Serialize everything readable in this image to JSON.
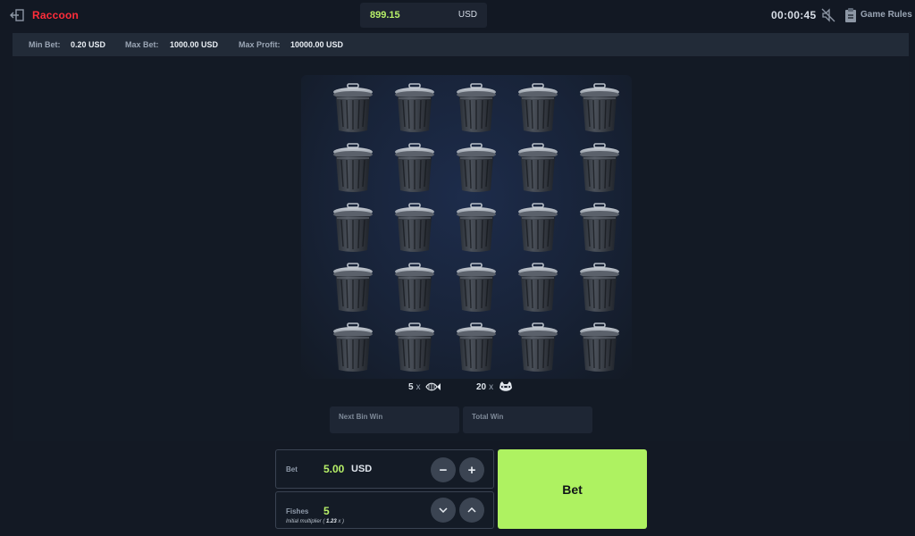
{
  "header": {
    "brand": "Raccoon",
    "balance_amount": "899.15",
    "balance_currency": "USD",
    "timer": "00:00:45",
    "rules_label": "Game Rules",
    "icons": [
      "back-icon",
      "sound-off-icon",
      "clipboard-icon"
    ]
  },
  "limits": {
    "min_bet_label": "Min Bet:",
    "min_bet_value": "0.20 USD",
    "max_bet_label": "Max Bet:",
    "max_bet_value": "1000.00 USD",
    "max_profit_label": "Max Profit:",
    "max_profit_value": "10000.00 USD"
  },
  "board": {
    "rows": 5,
    "cols": 5,
    "bin_icon": "trash-bin-icon"
  },
  "counters": {
    "fish_count": "5",
    "fish_suffix": "x",
    "fish_icon": "fish-icon",
    "raccoon_count": "20",
    "raccoon_suffix": "x",
    "raccoon_icon": "raccoon-icon"
  },
  "wins": {
    "next_bin_label": "Next Bin Win",
    "total_label": "Total Win"
  },
  "controls": {
    "bet_label": "Bet",
    "bet_value": "5.00",
    "bet_currency": "USD",
    "minus": "−",
    "plus": "+",
    "fishes_label": "Fishes",
    "fishes_value": "5",
    "initial_multiplier_label": "Initial multiplier (",
    "initial_multiplier_value": "1.23",
    "initial_multiplier_suffix": "x )",
    "bet_button": "Bet"
  },
  "colors": {
    "accent": "#aef261",
    "brand": "#ff2d3a",
    "background": "#131924"
  }
}
